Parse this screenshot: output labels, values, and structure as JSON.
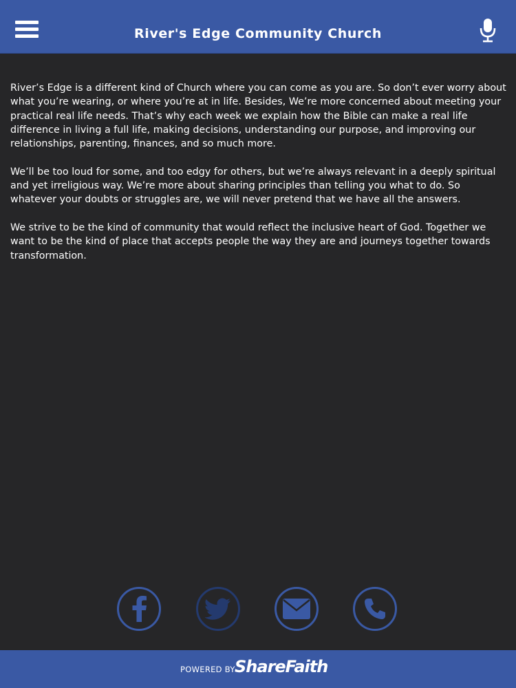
{
  "header": {
    "title": "River's Edge Community Church",
    "menu_icon": "hamburger-menu-icon",
    "mic_icon": "microphone-icon"
  },
  "content": {
    "paragraphs": [
      "River’s Edge is a different kind of Church where you can come as you are. So don’t ever worry about what you’re wearing, or where you’re at in life. Besides, We’re more concerned about meeting your practical real life needs. That’s why each week we explain how the Bible can make a real life difference in living a full life, making decisions, understanding our purpose, and improving our relationships, parenting, finances, and so much more.",
      "We’ll be too loud for some, and too edgy for others, but we’re always relevant in a deeply spiritual and yet irreligious way. We’re more about sharing principles than telling you what to do. So whatever your doubts or struggles are, we will never pretend that we have all the answers.",
      "We strive to be the kind of community that would reflect the inclusive heart of God. Together we want to be the kind of place that accepts people the way they are and journeys together towards transformation."
    ]
  },
  "social": [
    {
      "icon": "facebook-icon"
    },
    {
      "icon": "twitter-icon"
    },
    {
      "icon": "email-icon"
    },
    {
      "icon": "phone-icon"
    }
  ],
  "footer": {
    "powered_by": "POWERED BY",
    "brand": "ShareFaith"
  },
  "colors": {
    "background": "#262628",
    "accent": "#3a59a4",
    "text": "#ffffff"
  }
}
